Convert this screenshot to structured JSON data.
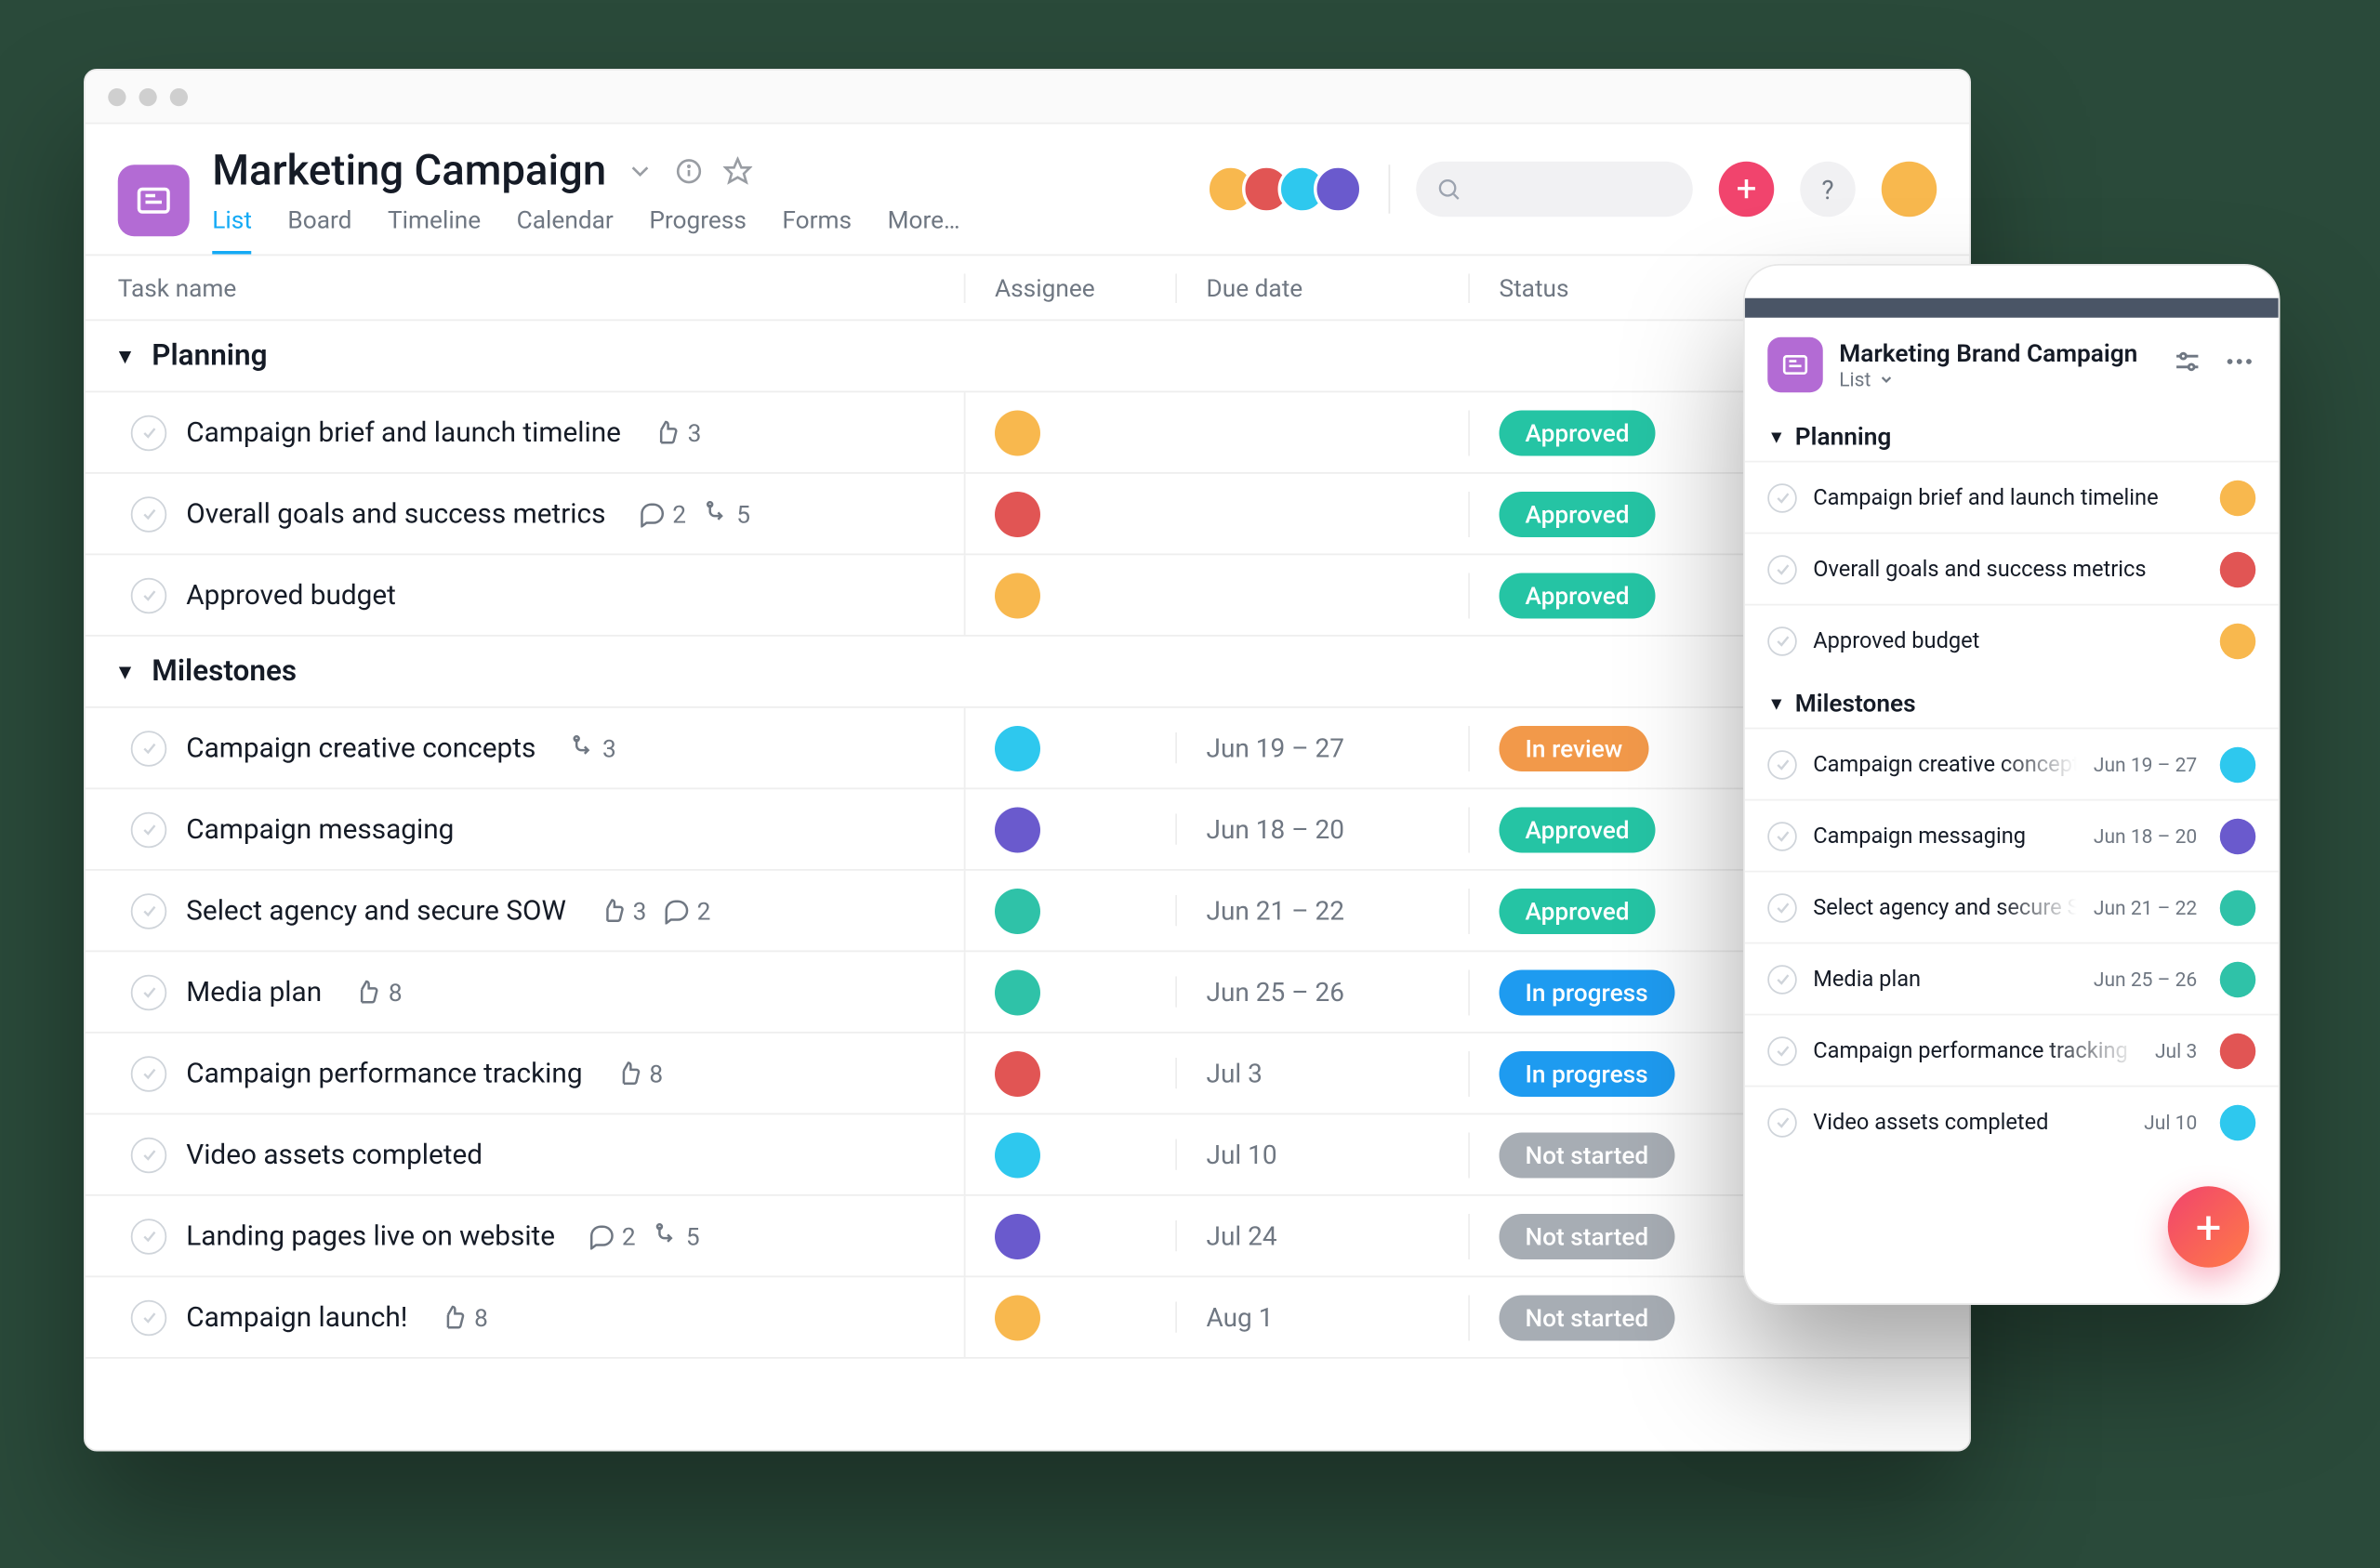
{
  "project": {
    "title": "Marketing Campaign",
    "tabs": [
      "List",
      "Board",
      "Timeline",
      "Calendar",
      "Progress",
      "Forms",
      "More…"
    ],
    "activeTab": 0
  },
  "columns": {
    "task": "Task name",
    "assignee": "Assignee",
    "due": "Due date",
    "status": "Status"
  },
  "statuses": {
    "approved": {
      "label": "Approved",
      "color": "#25c4a4"
    },
    "review": {
      "label": "In review",
      "color": "#f2994a"
    },
    "progress": {
      "label": "In progress",
      "color": "#1e9bf0"
    },
    "notstarted": {
      "label": "Not started",
      "color": "#a7adb4"
    }
  },
  "people": {
    "yellow": "#f8b84e",
    "red": "#e15554",
    "cyan": "#2ec8ee",
    "purple": "#6a5acd",
    "teal": "#2fc2a8"
  },
  "sections": [
    {
      "name": "Planning",
      "tasks": [
        {
          "name": "Campaign brief and launch timeline",
          "likes": 3,
          "assignee": "yellow",
          "due": "",
          "status": "approved"
        },
        {
          "name": "Overall goals and success metrics",
          "comments": 2,
          "subtasks": 5,
          "assignee": "red",
          "due": "",
          "status": "approved"
        },
        {
          "name": "Approved budget",
          "assignee": "yellow",
          "due": "",
          "status": "approved"
        }
      ]
    },
    {
      "name": "Milestones",
      "tasks": [
        {
          "name": "Campaign creative concepts",
          "subtasks": 3,
          "assignee": "cyan",
          "due": "Jun 19 – 27",
          "status": "review"
        },
        {
          "name": "Campaign messaging",
          "assignee": "purple",
          "due": "Jun 18 – 20",
          "status": "approved"
        },
        {
          "name": "Select agency and secure SOW",
          "likes": 3,
          "comments": 2,
          "assignee": "teal",
          "due": "Jun 21 – 22",
          "status": "approved"
        },
        {
          "name": "Media plan",
          "likes": 8,
          "assignee": "teal",
          "due": "Jun 25 – 26",
          "status": "progress"
        },
        {
          "name": "Campaign performance tracking",
          "likes": 8,
          "assignee": "red",
          "due": "Jul 3",
          "status": "progress"
        },
        {
          "name": "Video assets completed",
          "assignee": "cyan",
          "due": "Jul 10",
          "status": "notstarted"
        },
        {
          "name": "Landing pages live on website",
          "comments": 2,
          "subtasks": 5,
          "assignee": "purple",
          "due": "Jul 24",
          "status": "notstarted"
        },
        {
          "name": "Campaign launch!",
          "likes": 8,
          "assignee": "yellow",
          "due": "Aug 1",
          "status": "notstarted"
        }
      ]
    }
  ],
  "mobile": {
    "title": "Marketing Brand Campaign",
    "viewLabel": "List",
    "sections": [
      {
        "name": "Planning",
        "tasks": [
          {
            "name": "Campaign brief and launch timeline",
            "assignee": "yellow"
          },
          {
            "name": "Overall goals and success metrics",
            "assignee": "red"
          },
          {
            "name": "Approved budget",
            "assignee": "yellow"
          }
        ]
      },
      {
        "name": "Milestones",
        "tasks": [
          {
            "name": "Campaign creative concepts",
            "fade": true,
            "due": "Jun 19 – 27",
            "assignee": "cyan"
          },
          {
            "name": "Campaign messaging",
            "due": "Jun 18 – 20",
            "assignee": "purple"
          },
          {
            "name": "Select agency and secure SOW",
            "fade": true,
            "due": "Jun 21 – 22",
            "assignee": "teal"
          },
          {
            "name": "Media plan",
            "due": "Jun 25 – 26",
            "assignee": "teal"
          },
          {
            "name": "Campaign performance tracking",
            "fade": true,
            "due": "Jul 3",
            "assignee": "red"
          },
          {
            "name": "Video assets completed",
            "due": "Jul 10",
            "assignee": "cyan"
          }
        ]
      }
    ]
  }
}
